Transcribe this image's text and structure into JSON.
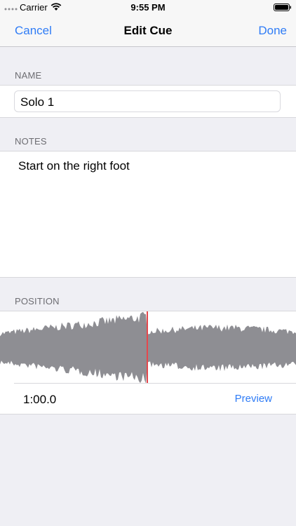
{
  "status_bar": {
    "carrier": "Carrier",
    "time": "9:55 PM",
    "icons": [
      "signal-icon",
      "wifi-icon",
      "battery-icon"
    ]
  },
  "nav": {
    "cancel_label": "Cancel",
    "title": "Edit Cue",
    "done_label": "Done"
  },
  "name_section": {
    "header": "NAME",
    "value": "Solo 1"
  },
  "notes_section": {
    "header": "NOTES",
    "value": "Start on the right foot"
  },
  "position_section": {
    "header": "POSITION",
    "time_value": "1:00.0",
    "preview_label": "Preview"
  },
  "colors": {
    "accent": "#2f7cf6",
    "background": "#efeff4",
    "waveform": "#8e8e93",
    "playhead": "#e5484d"
  }
}
